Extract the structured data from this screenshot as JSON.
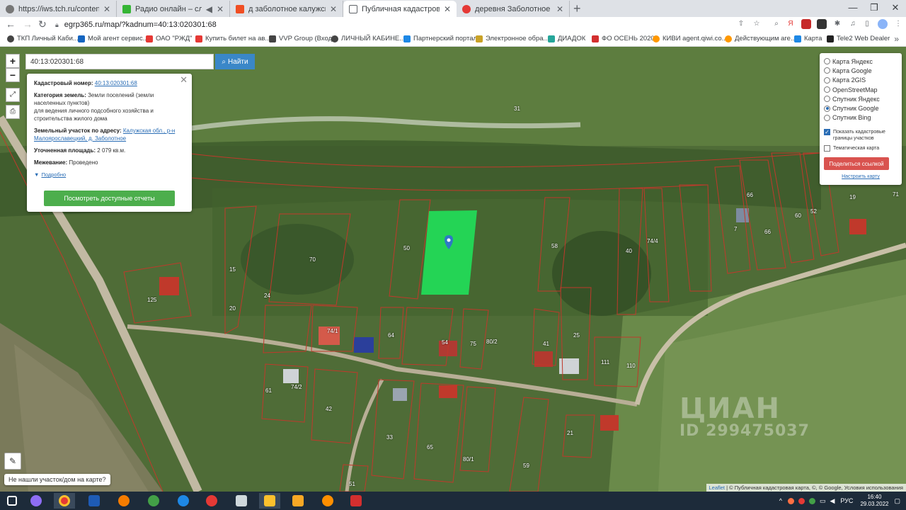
{
  "browser": {
    "tabs": [
      {
        "title": "https://iws.tch.ru/contentlinks?m",
        "favicon": "#777777"
      },
      {
        "title": "Радио онлайн – слушать бе",
        "favicon": "#35b535"
      },
      {
        "title": "д заболотное калужская област",
        "favicon": "#f04e23"
      },
      {
        "title": "Публичная кадастровая карта д",
        "favicon": "#5f6368"
      },
      {
        "title": "деревня Заболотное",
        "favicon": "#e53935"
      }
    ],
    "new_tab": "+",
    "url": "egrp365.ru/map/?kadnum=40:13:020301:68"
  },
  "bookmarks": [
    "ТКП Личный Каби...",
    "Мой агент сервис...",
    "ОАО \"РЖД\"",
    "Купить билет на ав...",
    "VVP Group (Вход)",
    "ЛИЧНЫЙ КАБИНЕ...",
    "Партнерский портал",
    "Электронное обра...",
    "ДИАДОК",
    "ФО ОСЕНЬ 2020",
    "КИВИ agent.qiwi.co...",
    "Действующим аге...",
    "Карта",
    "Tele2 Web Dealer"
  ],
  "map": {
    "search_value": "40:13:020301:68",
    "search_button": "Найти",
    "zoom_in": "+",
    "zoom_out": "−",
    "popup": {
      "cad_label": "Кадастровый номер:",
      "cad_value": "40:13:020301:68",
      "category_label": "Категория земель:",
      "category_value": "Земли поселений (земли населенных пунктов)",
      "usage": "для ведения личного подсобного хозяйства и строительства жилого дома",
      "address_label": "Земельный участок по адресу:",
      "address_value": "Калужская обл., р-н Малоярославецкий, д. Заболотное",
      "area_label": "Уточненная площадь:",
      "area_value": "2 079 кв.м.",
      "survey_label": "Межевание:",
      "survey_value": "Проведено",
      "details": "Подробно",
      "reports_button": "Посмотреть доступные отчеты"
    },
    "layers": {
      "options": [
        "Карта Яндекс",
        "Карта Google",
        "Карта 2GIS",
        "OpenStreetMap",
        "Спутник Яндекс",
        "Спутник Google",
        "Спутник Bing"
      ],
      "selected": "Спутник Google",
      "show_borders": "Показать кадастровые границы участков",
      "thematic": "Тематическая карта",
      "share_button": "Поделиться ссылкой",
      "configure": "Настроить карту"
    },
    "parcel_labels": [
      "31",
      "70",
      "50",
      "58",
      "15",
      "125",
      "24",
      "20",
      "74/1",
      "64",
      "54",
      "75",
      "80/2",
      "41",
      "25",
      "111",
      "110",
      "66",
      "66",
      "60",
      "7",
      "40",
      "74/4",
      "52",
      "19",
      "71",
      "42",
      "74/2",
      "33",
      "65",
      "80/1",
      "59",
      "21",
      "61",
      "51"
    ],
    "not_found": "Не нашли участок/дом на карте?",
    "attribution": {
      "leaflet": "Leaflet",
      "rest": " | © Публичная кадастровая карта, ©, © Google, Условия использования"
    },
    "watermark": {
      "brand": "ЦИАН",
      "id": "ID 299475037"
    },
    "accent": "#3a87c8",
    "selected_parcel_color": "#20e05a"
  },
  "taskbar": {
    "lang": "РУС",
    "time": "16:40",
    "date": "29.03.2022"
  }
}
